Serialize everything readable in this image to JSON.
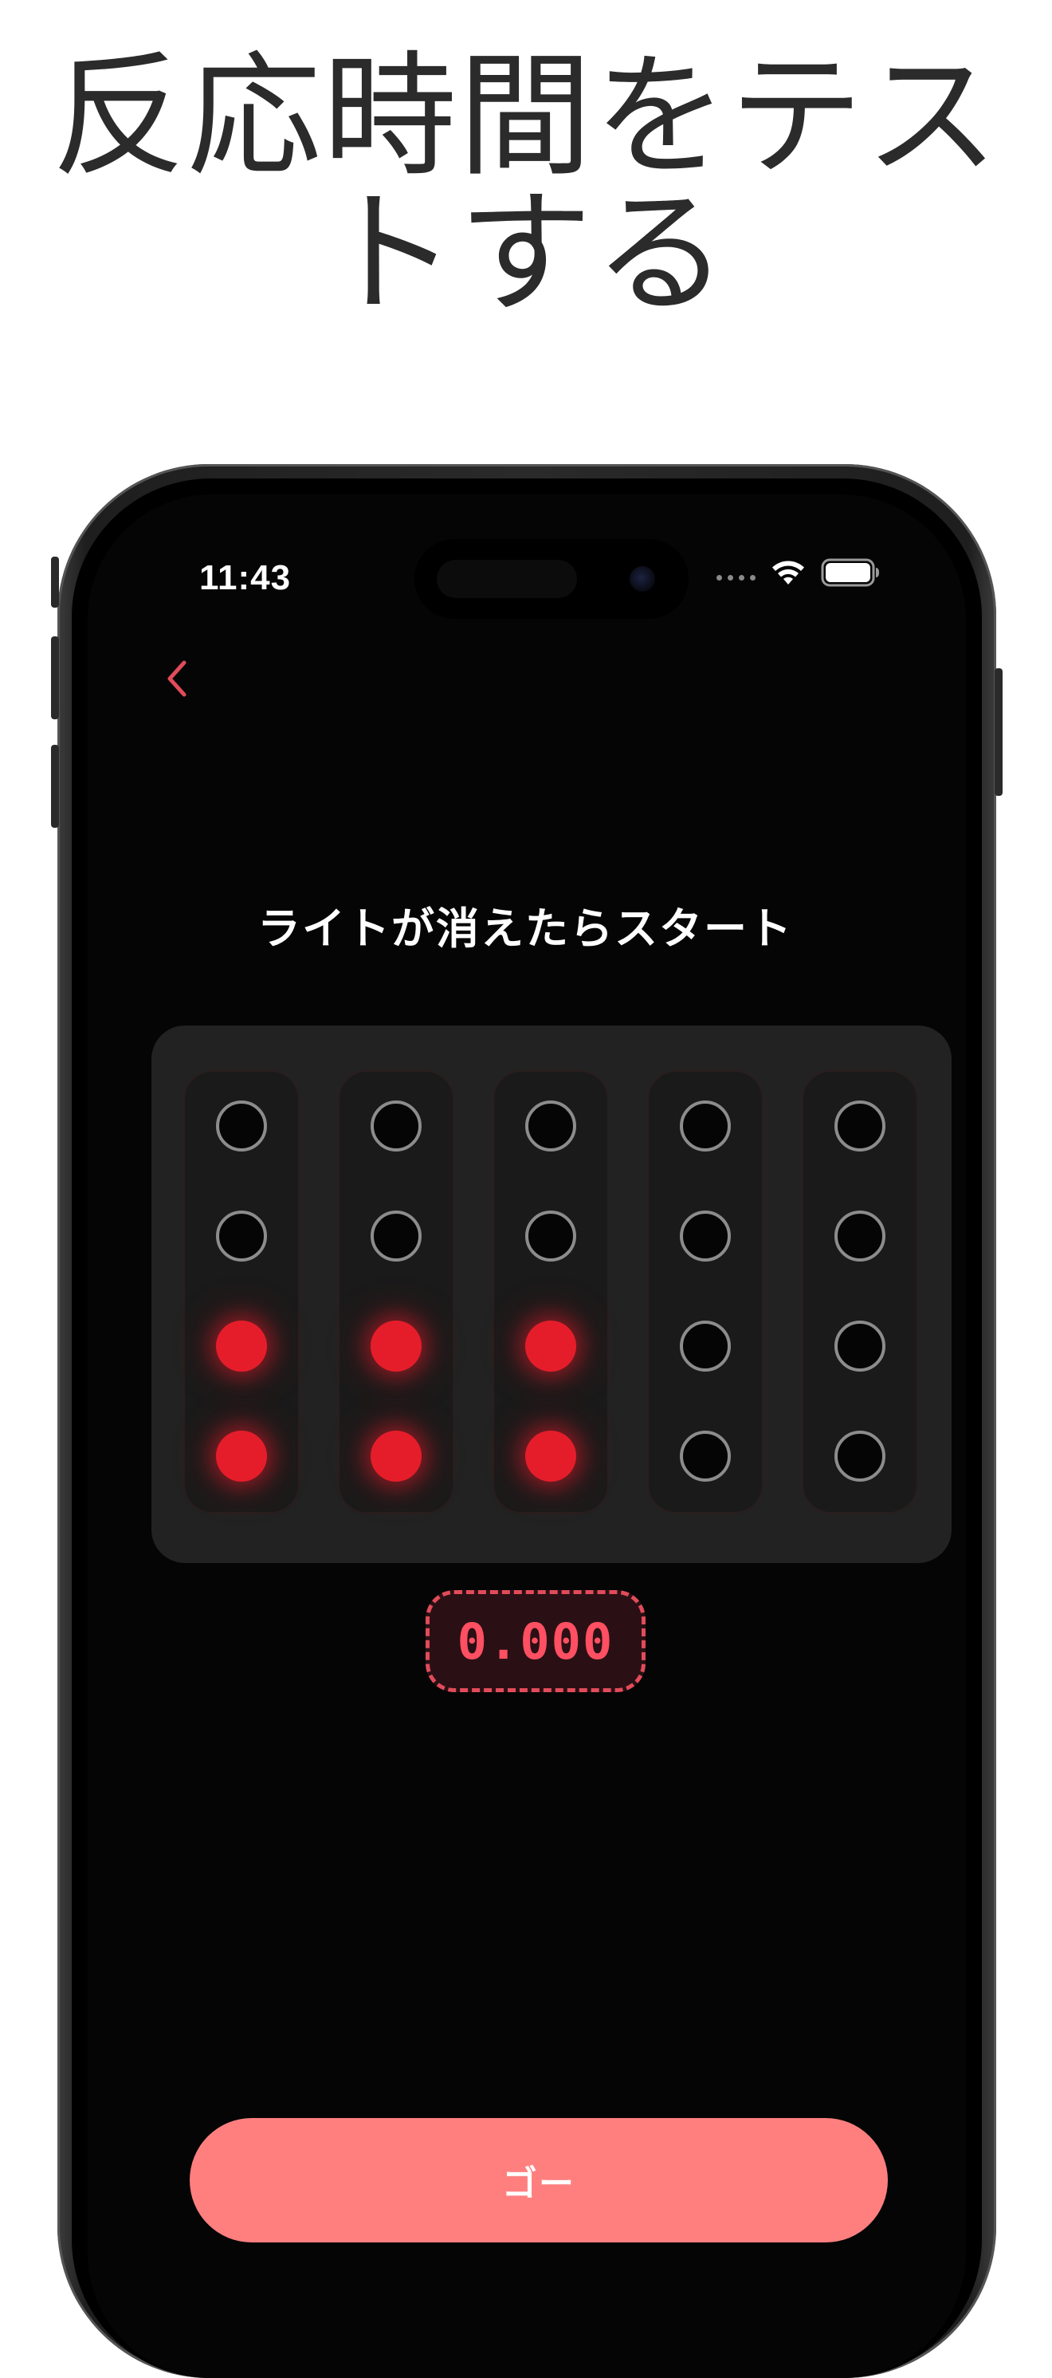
{
  "headline": {
    "line1": "反応時間をテス",
    "line2": "トする"
  },
  "status_bar": {
    "time": "11:43",
    "icons": [
      "signal-dots-icon",
      "wifi-icon",
      "battery-icon"
    ]
  },
  "nav": {
    "back_icon": "chevron-left-icon"
  },
  "instruction": "ライトが消えたらスタート",
  "lights": {
    "columns": [
      [
        "off",
        "off",
        "on",
        "on"
      ],
      [
        "off",
        "off",
        "on",
        "on"
      ],
      [
        "off",
        "off",
        "on",
        "on"
      ],
      [
        "off",
        "off",
        "off",
        "off"
      ],
      [
        "off",
        "off",
        "off",
        "off"
      ]
    ]
  },
  "timer": {
    "value": "0.000"
  },
  "go_button": {
    "label": "ゴー"
  },
  "colors": {
    "accent": "#ff7f7f",
    "light_on": "#e51d2b",
    "timer_text": "#ff4f62",
    "back_chevron": "#e24b5a"
  }
}
